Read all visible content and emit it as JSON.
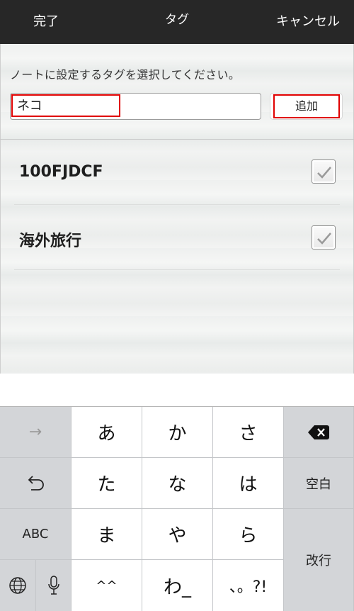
{
  "navbar": {
    "done_label": "完了",
    "title": "タグ",
    "cancel_label": "キャンセル"
  },
  "tag_editor": {
    "instruction": "ノートに設定するタグを選択してください。",
    "input_value": "ネコ",
    "add_label": "追加"
  },
  "tags": [
    {
      "label": "100FJDCF",
      "checked": true
    },
    {
      "label": "海外旅行",
      "checked": true
    }
  ],
  "keyboard": {
    "rows": [
      [
        "→",
        "あ",
        "か",
        "さ",
        "⌫"
      ],
      [
        "↺",
        "た",
        "な",
        "は",
        "空白"
      ],
      [
        "ABC",
        "ま",
        "や",
        "ら",
        "改行"
      ],
      [
        "🌐",
        "🎤",
        "^^",
        "わ_",
        "、。?!"
      ]
    ],
    "next_label": "→",
    "undo_label": "↺",
    "abc_label": "ABC",
    "space_label": "空白",
    "return_label": "改行",
    "keys": {
      "a": "あ",
      "ka": "か",
      "sa": "さ",
      "ta": "た",
      "na": "な",
      "ha": "は",
      "ma": "ま",
      "ya": "や",
      "ra": "ら",
      "dakuten": "^^",
      "wa": "わ_",
      "punct": "、。?!"
    }
  },
  "colors": {
    "navbar_bg": "#272727",
    "highlight": "#e00000",
    "key_gray": "#d3d5d8"
  }
}
